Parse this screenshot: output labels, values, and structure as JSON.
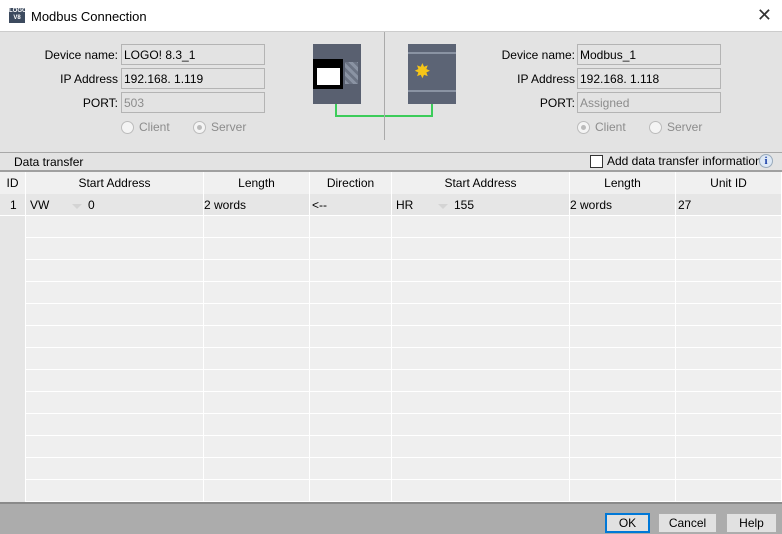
{
  "window": {
    "title": "Modbus Connection",
    "logo_text": "LOGO! V8"
  },
  "local": {
    "device_name_label": "Device name:",
    "device_name": "LOGO! 8.3_1",
    "ip_label": "IP Address",
    "ip": "192.168.  1.119",
    "port_label": "PORT:",
    "port": "503",
    "client": "Client",
    "server": "Server",
    "selected": "Server"
  },
  "remote": {
    "device_name_label": "Device name:",
    "device_name": "Modbus_1",
    "ip_label": "IP Address",
    "ip": "192.168.  1.118",
    "port_label": "PORT:",
    "port": "Assigned",
    "client": "Client",
    "server": "Server",
    "selected": "Client"
  },
  "section": {
    "title": "Data transfer",
    "add_info_label": "Add data transfer information",
    "add_info_checked": false
  },
  "table": {
    "headers": [
      "ID",
      "Start Address",
      "Length",
      "Direction",
      "Start Address",
      "Length",
      "Unit ID"
    ],
    "rows": [
      {
        "id": "1",
        "local_type": "VW",
        "local_addr": "0",
        "local_len": "2 words",
        "direction": "<--",
        "remote_type": "HR",
        "remote_addr": "155",
        "remote_len": "2 words",
        "unit_id": "27"
      }
    ]
  },
  "buttons": {
    "ok": "OK",
    "cancel": "Cancel",
    "help": "Help"
  }
}
